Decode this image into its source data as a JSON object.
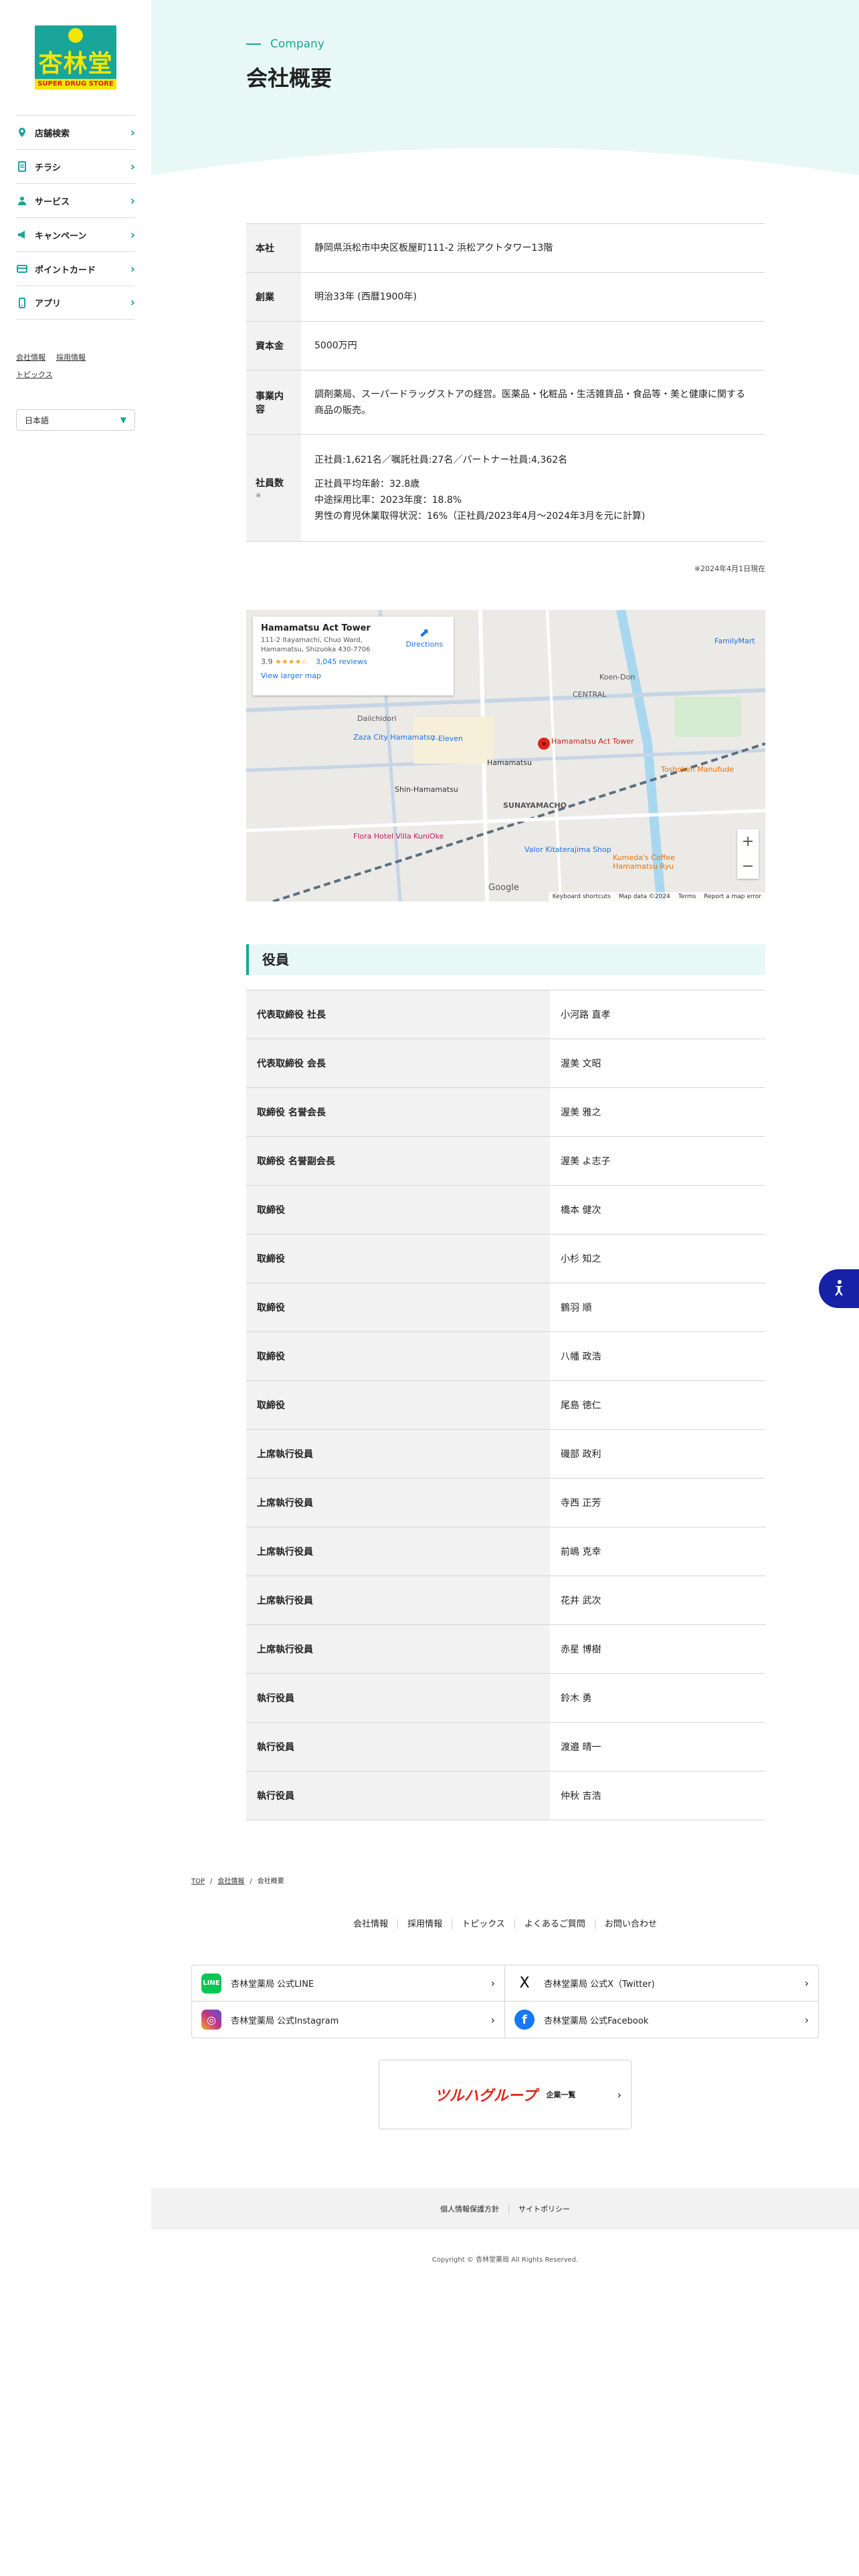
{
  "logo": {
    "name": "杏林堂",
    "band": "SUPER DRUG STORE"
  },
  "nav": [
    {
      "label": "店舗検索",
      "icon": "store-pin-icon"
    },
    {
      "label": "チラシ",
      "icon": "flyer-icon"
    },
    {
      "label": "サービス",
      "icon": "person-icon"
    },
    {
      "label": "キャンペーン",
      "icon": "megaphone-icon"
    },
    {
      "label": "ポイントカード",
      "icon": "card-icon"
    },
    {
      "label": "アプリ",
      "icon": "smartphone-icon"
    }
  ],
  "sublinks": [
    "会社情報",
    "採用情報",
    "トピックス"
  ],
  "language": "日本語",
  "hero": {
    "subtitle": "Company",
    "title": "会社概要"
  },
  "info": {
    "honsha": {
      "label": "本社",
      "value": "静岡県浜松市中央区板屋町111-2 浜松アクトタワー13階"
    },
    "sogyo": {
      "label": "創業",
      "value": "明治33年 (西暦1900年)"
    },
    "shihon": {
      "label": "資本金",
      "value": "5000万円"
    },
    "jigyo": {
      "label": "事業内容",
      "value": "調剤薬局、スーパードラッグストアの経営。医薬品・化粧品・生活雑貨品・食品等・美と健康に関する商品の販売。"
    },
    "jugyoin": {
      "label": "社員数",
      "mark": "※",
      "line1": "正社員:1,621名／嘱託社員:27名／パートナー社員:4,362名",
      "line2": "正社員平均年齢：32.8歳",
      "line3": "中途採用比率：2023年度：18.8%",
      "line4": "男性の育児休業取得状況：16%（正社員/2023年4月〜2024年3月を元に計算)"
    },
    "note": "※2024年4月1日現在"
  },
  "map": {
    "place": "Hamamatsu Act Tower",
    "address": "111-2 Itayamachi, Chuo Ward, Hamamatsu, Shizuoka 430-7706",
    "rating": "3.9",
    "stars": "★★★★☆",
    "reviews": "3,045 reviews",
    "larger": "View larger map",
    "directions": "Directions",
    "footer": [
      "Keyboard shortcuts",
      "Map data ©2024",
      "Terms",
      "Report a map error"
    ],
    "labels": {
      "central": "CENTRAL",
      "koen": "Koen-Don",
      "zaza": "Zaza City Hamamatsu",
      "eleven": "7-Eleven",
      "shin": "Shin-Hamamatsu",
      "hamamatsu": "Hamamatsu",
      "sunaya": "SUNAYAMACHO",
      "tower": "Hamamatsu Act Tower",
      "toshoken": "Toshoken Manufude",
      "valor": "Valor Kitaterajima Shop",
      "flora": "Flora Hotel Villa KuniOke",
      "kumeda": "Kumeda's Coffee Hamamatsu Ryu",
      "google": "Google",
      "dai": "Daiichidori",
      "family": "FamilyMart"
    }
  },
  "officers": {
    "title": "役員",
    "rows": [
      {
        "role": "代表取締役 社長",
        "name": "小河路 直孝"
      },
      {
        "role": "代表取締役 会長",
        "name": "渥美 文昭"
      },
      {
        "role": "取締役 名誉会長",
        "name": "渥美 雅之"
      },
      {
        "role": "取締役 名誉副会長",
        "name": "渥美 よ志子"
      },
      {
        "role": "取締役",
        "name": "橋本 健次"
      },
      {
        "role": "取締役",
        "name": "小杉 知之"
      },
      {
        "role": "取締役",
        "name": "鶴羽 順"
      },
      {
        "role": "取締役",
        "name": "八幡 政浩"
      },
      {
        "role": "取締役",
        "name": "尾島 徳仁"
      },
      {
        "role": "上席執行役員",
        "name": "磯部 政利"
      },
      {
        "role": "上席執行役員",
        "name": "寺西 正芳"
      },
      {
        "role": "上席執行役員",
        "name": "前嶋 克幸"
      },
      {
        "role": "上席執行役員",
        "name": "花井 武次"
      },
      {
        "role": "上席執行役員",
        "name": "赤星 博樹"
      },
      {
        "role": "執行役員",
        "name": "鈴木 勇"
      },
      {
        "role": "執行役員",
        "name": "渡邉 晴一"
      },
      {
        "role": "執行役員",
        "name": "仲秋 吉浩"
      }
    ]
  },
  "breadcrumb": [
    "TOP",
    "会社情報",
    "会社概要"
  ],
  "footer_links": [
    "会社情報",
    "採用情報",
    "トピックス",
    "よくあるご質問",
    "お問い合わせ"
  ],
  "social": [
    {
      "label": "杏林堂薬局 公式LINE",
      "icon": "line-icon",
      "glyph": "LINE",
      "color": "#06c755"
    },
    {
      "label": "杏林堂薬局 公式X（Twitter)",
      "icon": "x-icon",
      "glyph": "X",
      "color": "#000000"
    },
    {
      "label": "杏林堂薬局 公式Instagram",
      "icon": "instagram-icon",
      "glyph": "◎",
      "color": "#c13584"
    },
    {
      "label": "杏林堂薬局 公式Facebook",
      "icon": "facebook-icon",
      "glyph": "f",
      "color": "#1877f2"
    }
  ],
  "group": {
    "logo": "ツルハグループ",
    "text": "企業一覧"
  },
  "footer_bar": [
    "個人情報保護方針",
    "サイトポリシー"
  ],
  "copyright": "Copyright © 杏林堂薬局 All Rights Reserved.",
  "colors": {
    "accent": "#1aa59a",
    "hero_bg": "#e7f8f6",
    "a11y": "#1621a8"
  }
}
